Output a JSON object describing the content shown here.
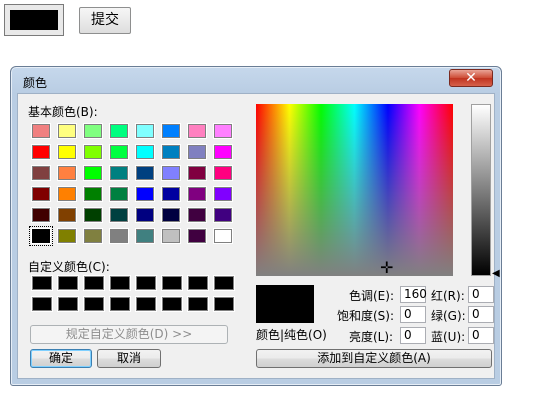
{
  "top": {
    "submit_label": "提交"
  },
  "dialog": {
    "title": "颜色",
    "close_symbol": "✕",
    "basic_colors_label": "基本颜色(B):",
    "basic_colors": [
      [
        "#f08080",
        "#ffff80",
        "#80ff80",
        "#00ff80",
        "#80ffff",
        "#0080ff",
        "#ff80c0",
        "#ff80ff"
      ],
      [
        "#ff0000",
        "#ffff00",
        "#80ff00",
        "#00ff40",
        "#00ffff",
        "#0080c0",
        "#8080c0",
        "#ff00ff"
      ],
      [
        "#804040",
        "#ff8040",
        "#00ff00",
        "#008080",
        "#004080",
        "#8080ff",
        "#800040",
        "#ff0080"
      ],
      [
        "#800000",
        "#ff8000",
        "#008000",
        "#008040",
        "#0000ff",
        "#0000a0",
        "#800080",
        "#8000ff"
      ],
      [
        "#400000",
        "#804000",
        "#004000",
        "#004040",
        "#000080",
        "#000040",
        "#400040",
        "#400080"
      ],
      [
        "#000000",
        "#808000",
        "#808040",
        "#808080",
        "#408080",
        "#c0c0c0",
        "#400040",
        "#ffffff"
      ]
    ],
    "custom_colors_label": "自定义颜色(C):",
    "custom_colors": [
      [
        "#000000",
        "#000000",
        "#000000",
        "#000000",
        "#000000",
        "#000000",
        "#000000",
        "#000000"
      ],
      [
        "#000000",
        "#000000",
        "#000000",
        "#000000",
        "#000000",
        "#000000",
        "#000000",
        "#000000"
      ]
    ],
    "define_custom_label": "规定自定义颜色(D) >>",
    "ok_label": "确定",
    "cancel_label": "取消",
    "color_solid_label": "颜色|纯色(O)",
    "hue_label": "色调(E):",
    "hue_value": "160",
    "sat_label": "饱和度(S):",
    "sat_value": "0",
    "lum_label": "亮度(L):",
    "lum_value": "0",
    "red_label": "红(R):",
    "red_value": "0",
    "green_label": "绿(G):",
    "green_value": "0",
    "blue_label": "蓝(U):",
    "blue_value": "0",
    "add_custom_label": "添加到自定义颜色(A)",
    "crosshair_symbol": "✛",
    "lum_arrow_symbol": "◀"
  }
}
